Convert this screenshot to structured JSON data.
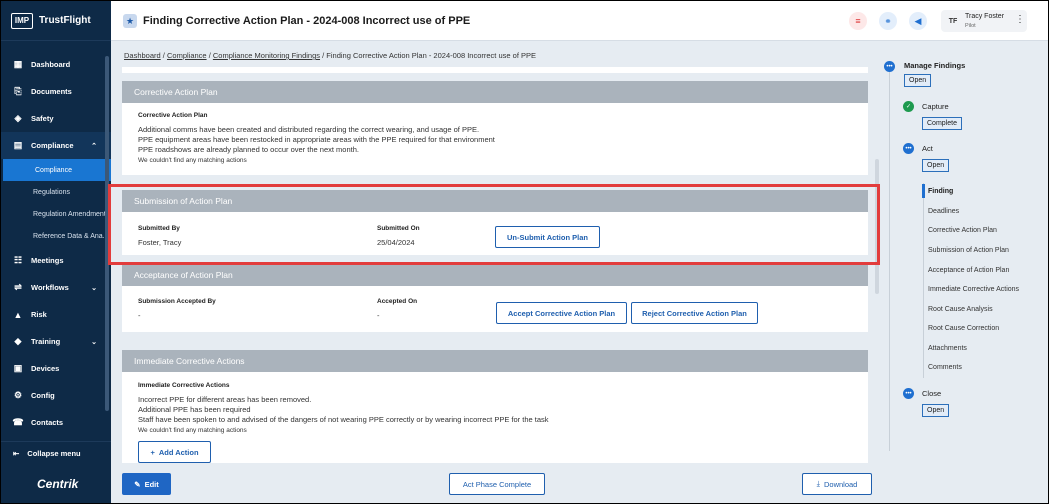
{
  "app": {
    "logo_abbr": "IMP",
    "logo_name": "TrustFlight",
    "brand": "Centrik"
  },
  "sidebar": {
    "items": [
      {
        "label": "Dashboard",
        "icon": "dashboard-icon"
      },
      {
        "label": "Documents",
        "icon": "paperclip-icon"
      },
      {
        "label": "Safety",
        "icon": "shield-icon"
      },
      {
        "label": "Compliance",
        "icon": "clipboard-icon",
        "chevron": "⌃"
      },
      {
        "label": "Meetings",
        "icon": "meeting-icon"
      },
      {
        "label": "Workflows",
        "icon": "workflow-icon",
        "chevron": "⌄"
      },
      {
        "label": "Risk",
        "icon": "risk-icon"
      },
      {
        "label": "Training",
        "icon": "training-icon",
        "chevron": "⌄"
      },
      {
        "label": "Devices",
        "icon": "devices-icon"
      },
      {
        "label": "Config",
        "icon": "config-icon"
      },
      {
        "label": "Contacts",
        "icon": "contacts-icon"
      }
    ],
    "compliance_sub": [
      "Compliance",
      "Regulations",
      "Regulation Amendments",
      "Reference Data & Ana..."
    ],
    "collapse_label": "Collapse menu"
  },
  "header": {
    "title": "Finding Corrective Action Plan - 2024-008 Incorrect use of PPE",
    "user_initials": "TF",
    "user_name": "Tracy Foster",
    "user_role": "Pilot"
  },
  "breadcrumb": {
    "items": [
      "Dashboard",
      "Compliance",
      "Compliance Monitoring Findings"
    ],
    "current": "Finding Corrective Action Plan - 2024-008 Incorrect use of PPE",
    "sep": "/"
  },
  "cap": {
    "heading": "Corrective Action Plan",
    "label": "Corrective Action Plan",
    "lines": [
      "Additional comms have been created and distributed regarding the correct wearing, and usage of PPE.",
      "PPE equipment areas have been restocked in appropriate areas with the PPE required for that environment",
      "PPE roadshows are already planned to occur over the next month."
    ],
    "note": "We couldn't find any matching actions"
  },
  "submission": {
    "heading": "Submission of Action Plan",
    "submitted_by_label": "Submitted By",
    "submitted_by": "Foster, Tracy",
    "submitted_on_label": "Submitted On",
    "submitted_on": "25/04/2024",
    "button": "Un-Submit Action Plan"
  },
  "acceptance": {
    "heading": "Acceptance of Action Plan",
    "accepted_by_label": "Submission Accepted By",
    "accepted_by": "-",
    "accepted_on_label": "Accepted On",
    "accepted_on": "-",
    "accept_button": "Accept Corrective Action Plan",
    "reject_button": "Reject Corrective Action Plan"
  },
  "immediate": {
    "heading": "Immediate Corrective Actions",
    "label": "Immediate Corrective Actions",
    "lines": [
      "Incorrect PPE for different areas has been removed.",
      "Additional PPE has been required",
      "Staff have been spoken to and advised of the dangers of not wearing PPE correctly or by wearing incorrect PPE for the task"
    ],
    "note": "We couldn't find any matching actions",
    "add_button": "Add Action"
  },
  "steps": {
    "manage": {
      "label": "Manage Findings",
      "badge": "Open"
    },
    "capture": {
      "label": "Capture",
      "badge": "Complete"
    },
    "act": {
      "label": "Act",
      "badge": "Open"
    },
    "act_items": [
      "Finding",
      "Deadlines",
      "Corrective Action Plan",
      "Submission of Action Plan",
      "Acceptance of Action Plan",
      "Immediate Corrective Actions",
      "Root Cause Analysis",
      "Root Cause Correction",
      "Attachments",
      "Comments"
    ],
    "close": {
      "label": "Close",
      "badge": "Open"
    }
  },
  "footer": {
    "edit": "Edit",
    "phase": "Act Phase Complete",
    "download": "Download"
  },
  "colors": {
    "sidebar_bg": "#0e2a47",
    "accent": "#1976d2",
    "highlight": "#e23c3c",
    "card_header": "#aab3bc"
  }
}
